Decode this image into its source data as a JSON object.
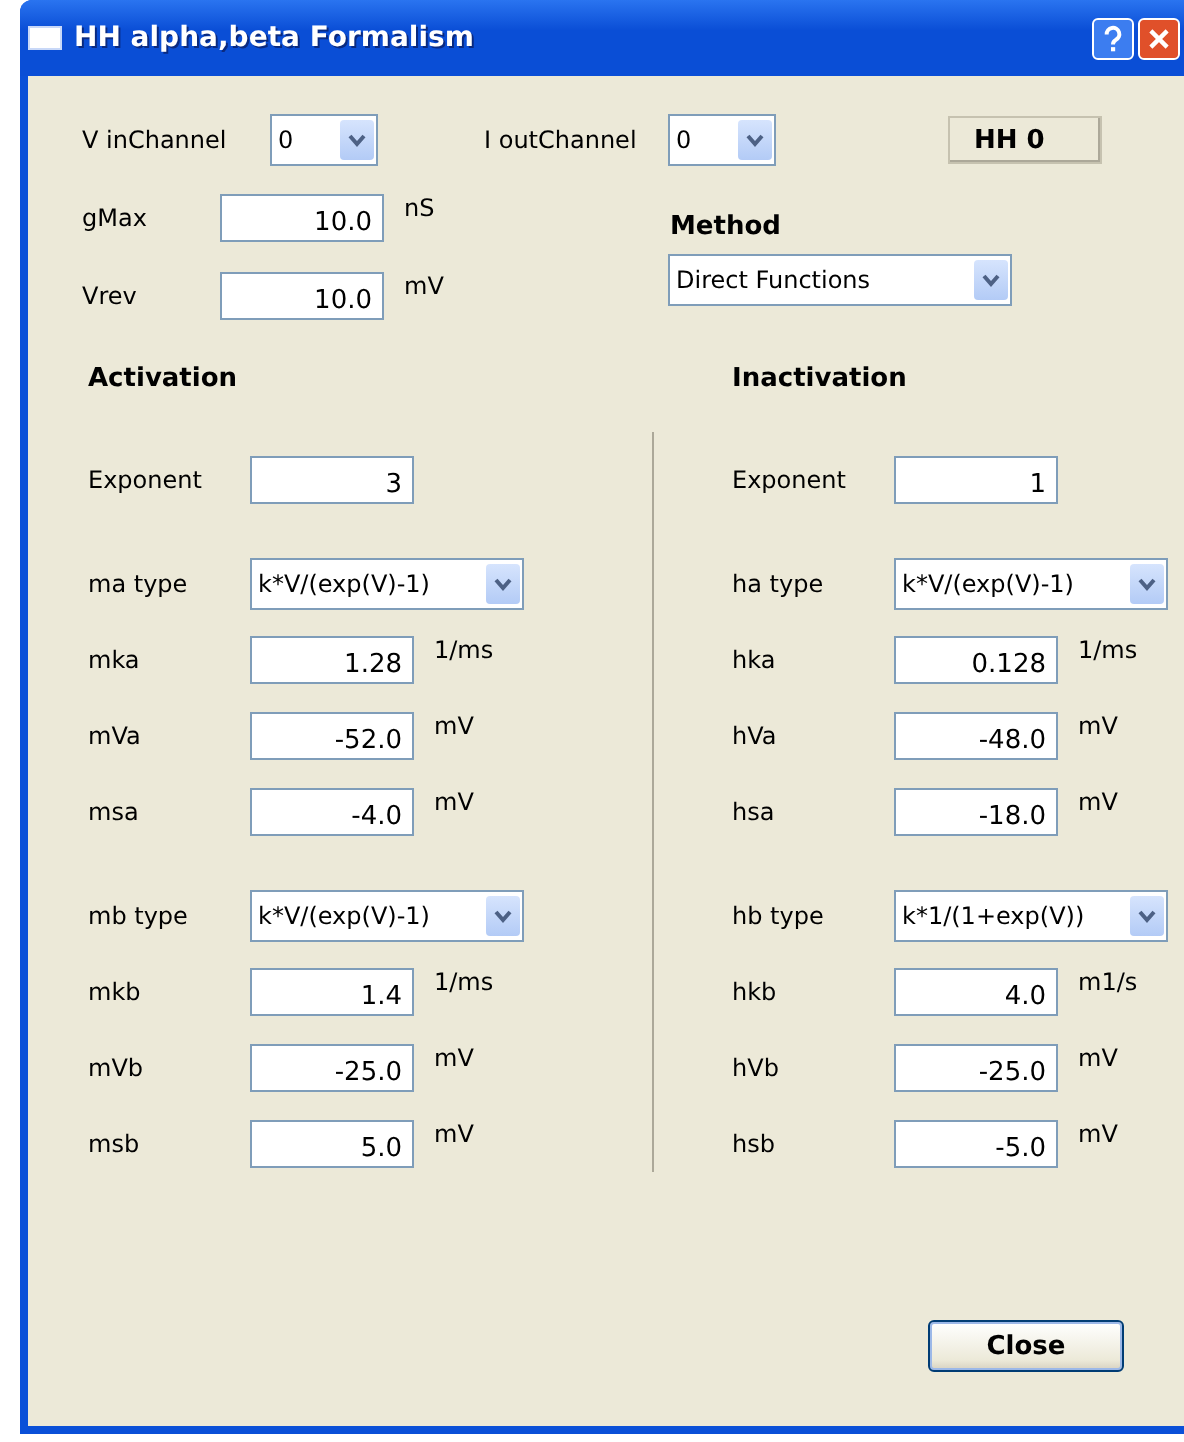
{
  "window": {
    "title": "HH alpha,beta Formalism"
  },
  "top": {
    "in_channel": {
      "label": "V inChannel",
      "value": "0"
    },
    "out_channel": {
      "label": "I outChannel",
      "value": "0"
    },
    "name_badge": "HH 0",
    "gmax": {
      "label": "gMax",
      "value": "10.0",
      "unit": "nS"
    },
    "vrev": {
      "label": "Vrev",
      "value": "10.0",
      "unit": "mV"
    },
    "method": {
      "label": "Method",
      "value": "Direct Functions"
    }
  },
  "sections": [
    {
      "title": "Activation",
      "exponent": {
        "label": "Exponent",
        "value": "3"
      },
      "groups": [
        {
          "type": {
            "label": "ma type",
            "value": "k*V/(exp(V)-1)"
          },
          "params": [
            {
              "label": "mka",
              "value": "1.28",
              "unit": "1/ms"
            },
            {
              "label": "mVa",
              "value": "-52.0",
              "unit": "mV"
            },
            {
              "label": "msa",
              "value": "-4.0",
              "unit": "mV"
            }
          ]
        },
        {
          "type": {
            "label": "mb type",
            "value": "k*V/(exp(V)-1)"
          },
          "params": [
            {
              "label": "mkb",
              "value": "1.4",
              "unit": "1/ms"
            },
            {
              "label": "mVb",
              "value": "-25.0",
              "unit": "mV"
            },
            {
              "label": "msb",
              "value": "5.0",
              "unit": "mV"
            }
          ]
        }
      ]
    },
    {
      "title": "Inactivation",
      "exponent": {
        "label": "Exponent",
        "value": "1"
      },
      "groups": [
        {
          "type": {
            "label": "ha type",
            "value": "k*V/(exp(V)-1)"
          },
          "params": [
            {
              "label": "hka",
              "value": "0.128",
              "unit": "1/ms"
            },
            {
              "label": "hVa",
              "value": "-48.0",
              "unit": "mV"
            },
            {
              "label": "hsa",
              "value": "-18.0",
              "unit": "mV"
            }
          ]
        },
        {
          "type": {
            "label": "hb type",
            "value": "k*1/(1+exp(V))"
          },
          "params": [
            {
              "label": "hkb",
              "value": "4.0",
              "unit": "m1/s"
            },
            {
              "label": "hVb",
              "value": "-25.0",
              "unit": "mV"
            },
            {
              "label": "hsb",
              "value": "-5.0",
              "unit": "mV"
            }
          ]
        }
      ]
    }
  ],
  "buttons": {
    "close": "Close"
  }
}
